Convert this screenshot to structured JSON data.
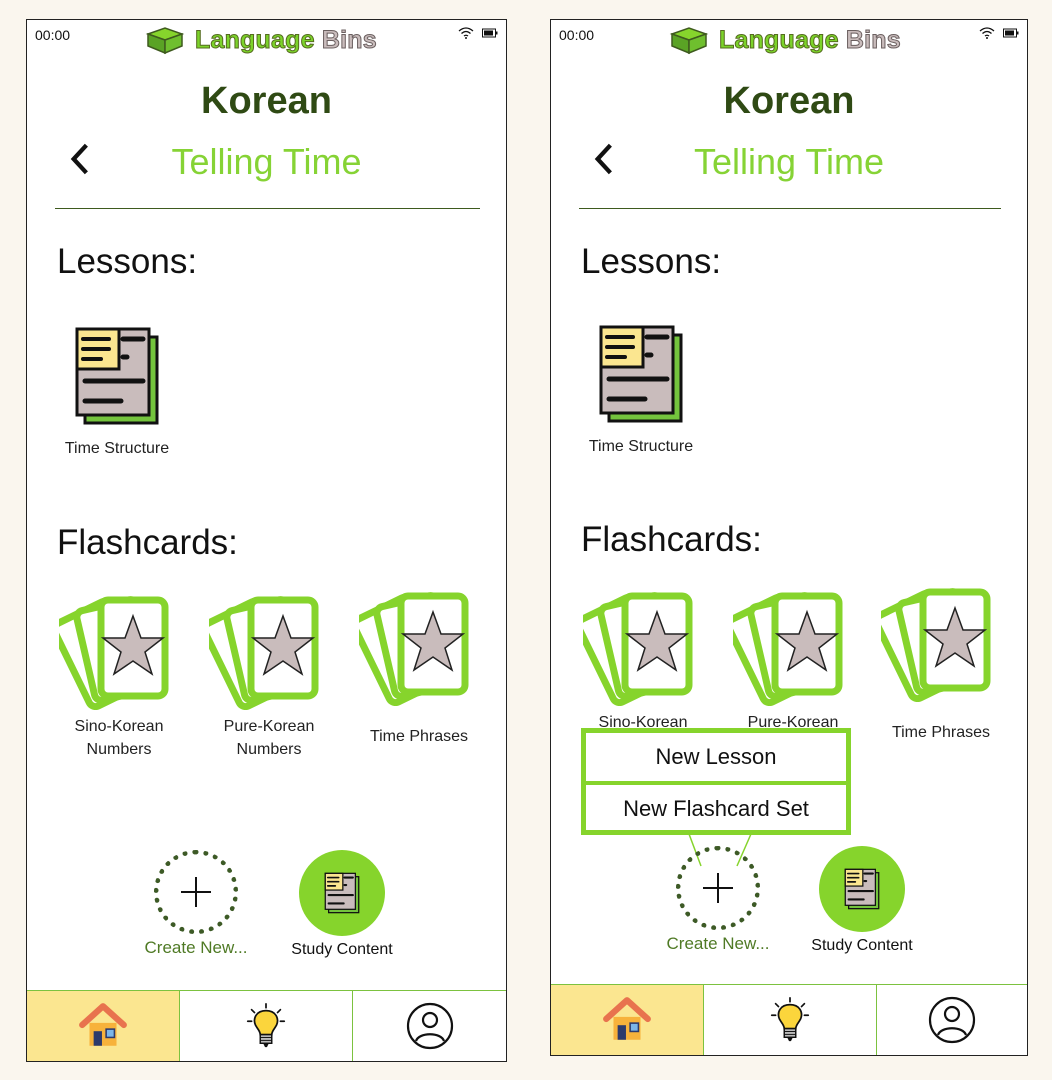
{
  "status": {
    "time": "00:00"
  },
  "brand": {
    "name_part1": "Language",
    "name_part2": "Bins"
  },
  "header": {
    "title": "Korean",
    "subtitle": "Telling Time"
  },
  "sections": {
    "lessons": "Lessons:",
    "flashcards": "Flashcards:"
  },
  "lessons": [
    {
      "label": "Time Structure"
    }
  ],
  "flashcards": [
    {
      "line1": "Sino-Korean",
      "line2": "Numbers"
    },
    {
      "line1": "Pure-Korean",
      "line2": "Numbers"
    },
    {
      "line1": "Time Phrases",
      "line2": ""
    }
  ],
  "actions": {
    "create": "Create New...",
    "study": "Study Content"
  },
  "create_menu": {
    "new_lesson": "New Lesson",
    "new_flashcard_set": "New Flashcard Set"
  },
  "nav": {
    "items": [
      "home-icon",
      "lightbulb-icon",
      "profile-icon"
    ],
    "active": "home"
  },
  "colors": {
    "accent_green": "#86d42c",
    "dark_green": "#2f4a14",
    "nav_active": "#fbe690"
  }
}
